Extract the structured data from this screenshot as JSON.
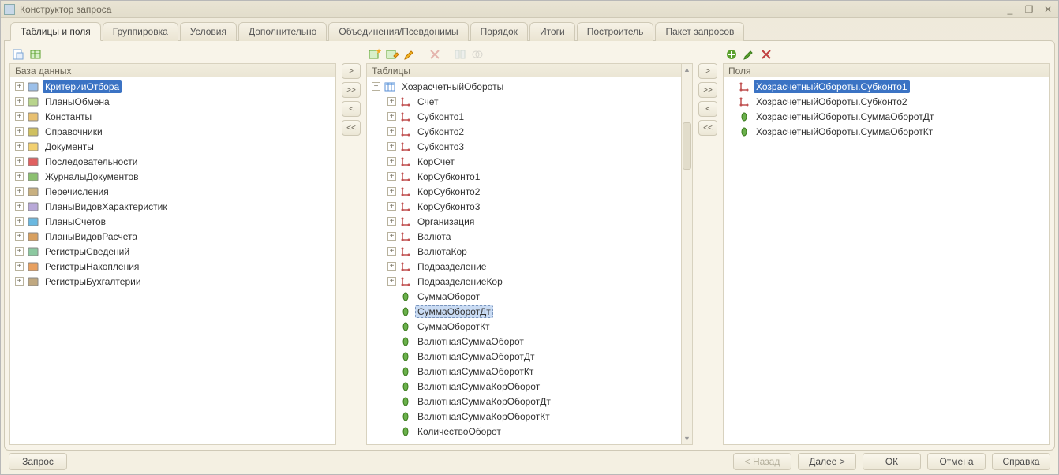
{
  "window": {
    "title": "Конструктор запроса"
  },
  "tabs": [
    {
      "label": "Таблицы и поля",
      "active": true
    },
    {
      "label": "Группировка"
    },
    {
      "label": "Условия"
    },
    {
      "label": "Дополнительно"
    },
    {
      "label": "Объединения/Псевдонимы"
    },
    {
      "label": "Порядок"
    },
    {
      "label": "Итоги"
    },
    {
      "label": "Построитель"
    },
    {
      "label": "Пакет запросов"
    }
  ],
  "panes": {
    "database": {
      "header": "База данных",
      "items": [
        {
          "label": "КритерииОтбора",
          "icon": "filter",
          "selected": true
        },
        {
          "label": "ПланыОбмена",
          "icon": "exchange"
        },
        {
          "label": "Константы",
          "icon": "constants"
        },
        {
          "label": "Справочники",
          "icon": "catalog"
        },
        {
          "label": "Документы",
          "icon": "document"
        },
        {
          "label": "Последовательности",
          "icon": "sequence"
        },
        {
          "label": "ЖурналыДокументов",
          "icon": "journal"
        },
        {
          "label": "Перечисления",
          "icon": "enum"
        },
        {
          "label": "ПланыВидовХарактеристик",
          "icon": "chartchar"
        },
        {
          "label": "ПланыСчетов",
          "icon": "chartacc"
        },
        {
          "label": "ПланыВидовРасчета",
          "icon": "chartcalc"
        },
        {
          "label": "РегистрыСведений",
          "icon": "inforeg"
        },
        {
          "label": "РегистрыНакопления",
          "icon": "accreg"
        },
        {
          "label": "РегистрыБухгалтерии",
          "icon": "bookreg"
        }
      ]
    },
    "tables": {
      "header": "Таблицы",
      "root": "ХозрасчетныйОбороты",
      "fields": [
        {
          "label": "Счет",
          "icon": "dim",
          "expandable": true
        },
        {
          "label": "Субконто1",
          "icon": "dim",
          "expandable": true
        },
        {
          "label": "Субконто2",
          "icon": "dim",
          "expandable": true
        },
        {
          "label": "Субконто3",
          "icon": "dim",
          "expandable": true
        },
        {
          "label": "КорСчет",
          "icon": "dim",
          "expandable": true
        },
        {
          "label": "КорСубконто1",
          "icon": "dim",
          "expandable": true
        },
        {
          "label": "КорСубконто2",
          "icon": "dim",
          "expandable": true
        },
        {
          "label": "КорСубконто3",
          "icon": "dim",
          "expandable": true
        },
        {
          "label": "Организация",
          "icon": "dim",
          "expandable": true
        },
        {
          "label": "Валюта",
          "icon": "dim",
          "expandable": true
        },
        {
          "label": "ВалютаКор",
          "icon": "dim",
          "expandable": true
        },
        {
          "label": "Подразделение",
          "icon": "dim",
          "expandable": true
        },
        {
          "label": "ПодразделениеКор",
          "icon": "dim",
          "expandable": true
        },
        {
          "label": "СуммаОборот",
          "icon": "resource"
        },
        {
          "label": "СуммаОборотДт",
          "icon": "resource",
          "selected": true
        },
        {
          "label": "СуммаОборотКт",
          "icon": "resource"
        },
        {
          "label": "ВалютнаяСуммаОборот",
          "icon": "resource"
        },
        {
          "label": "ВалютнаяСуммаОборотДт",
          "icon": "resource"
        },
        {
          "label": "ВалютнаяСуммаОборотКт",
          "icon": "resource"
        },
        {
          "label": "ВалютнаяСуммаКорОборот",
          "icon": "resource"
        },
        {
          "label": "ВалютнаяСуммаКорОборотДт",
          "icon": "resource"
        },
        {
          "label": "ВалютнаяСуммаКорОборотКт",
          "icon": "resource"
        },
        {
          "label": "КоличествоОборот",
          "icon": "resource"
        }
      ]
    },
    "fields": {
      "header": "Поля",
      "items": [
        {
          "label": "ХозрасчетныйОбороты.Субконто1",
          "icon": "dim",
          "selected": true
        },
        {
          "label": "ХозрасчетныйОбороты.Субконто2",
          "icon": "dim"
        },
        {
          "label": "ХозрасчетныйОбороты.СуммаОборотДт",
          "icon": "resource"
        },
        {
          "label": "ХозрасчетныйОбороты.СуммаОборотКт",
          "icon": "resource"
        }
      ]
    }
  },
  "buttons": {
    "query": "Запрос",
    "back": "< Назад",
    "next": "Далее >",
    "ok": "ОК",
    "cancel": "Отмена",
    "help": "Справка"
  },
  "movers": {
    "right": ">",
    "rightAll": ">>",
    "left": "<",
    "leftAll": "<<"
  }
}
